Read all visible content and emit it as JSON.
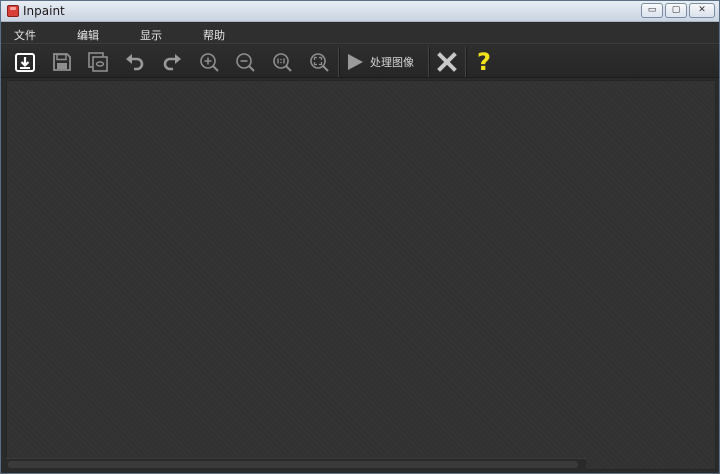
{
  "window": {
    "title": "Inpaint",
    "controls": {
      "minimize": "▭",
      "maximize": "▢",
      "close": "✕"
    }
  },
  "menu": {
    "items": [
      {
        "label": "文件"
      },
      {
        "label": "编辑"
      },
      {
        "label": "显示"
      },
      {
        "label": "帮助"
      }
    ]
  },
  "toolbar": {
    "icons": [
      "open-icon",
      "save-icon",
      "save-as-icon",
      "undo-icon",
      "redo-icon",
      "zoom-in-icon",
      "zoom-out-icon",
      "zoom-actual-icon",
      "zoom-fit-icon",
      "play-icon",
      "clear-icon",
      "help-icon"
    ],
    "process_label": "处理图像",
    "help_glyph": "?",
    "colors": {
      "icon": "#9a9a9a",
      "help": "#f2e21c",
      "clear": "#c8c8c8",
      "open": "#ffffff"
    }
  }
}
